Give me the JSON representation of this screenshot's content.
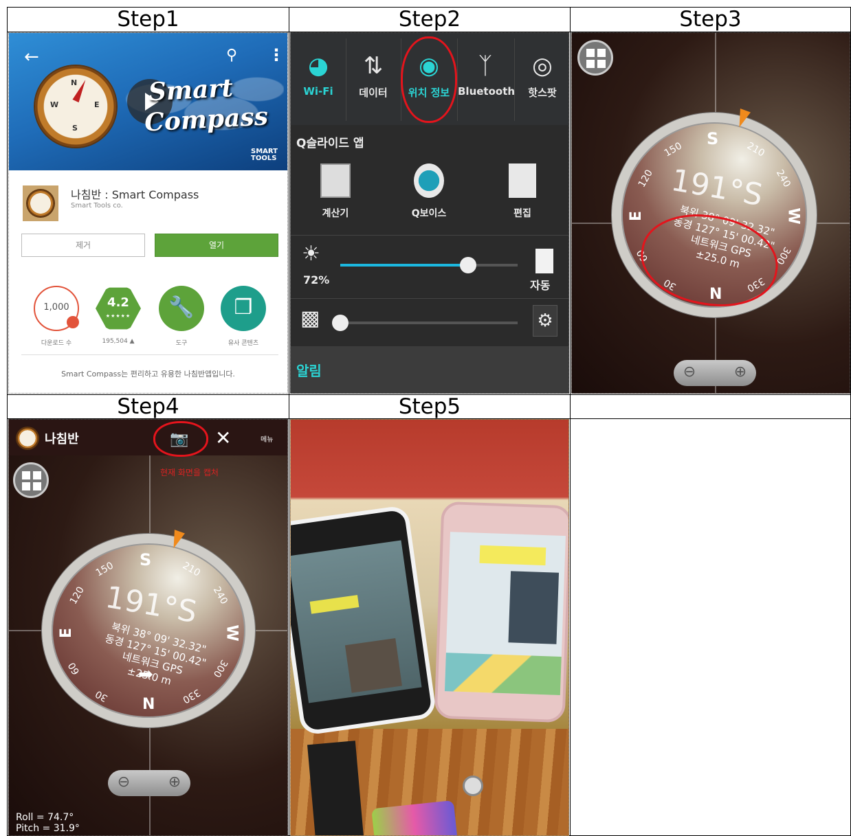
{
  "headers": {
    "step1": "Step1",
    "step2": "Step2",
    "step3": "Step3",
    "step4": "Step4",
    "step5": "Step5"
  },
  "step1": {
    "banner_title_line1": "Smart",
    "banner_title_line2": "Compass",
    "banner_brand_line1": "SMART",
    "banner_brand_line2": "TOOLS",
    "app_name": "나침반 : Smart Compass",
    "developer": "Smart Tools co.",
    "uninstall_label": "제거",
    "open_label": "열기",
    "downloads_value": "1,000",
    "downloads_label": "다운로드 수",
    "rating_value": "4.2",
    "rating_stars": "★★★★★",
    "rating_count": "195,504 ▲",
    "category_label": "도구",
    "similar_label": "유사 콘텐츠",
    "description": "Smart Compass는 편리하고 유용한 나침반앱입니다.",
    "icons": [
      "back-arrow",
      "search",
      "more-vert",
      "play",
      "download",
      "wrench",
      "cards"
    ],
    "colors": {
      "banner": "#1f6cb8",
      "open_button": "#5da33a"
    }
  },
  "step2": {
    "tiles": [
      {
        "label": "Wi-Fi",
        "icon": "wifi-icon",
        "active": true
      },
      {
        "label": "데이터",
        "icon": "data-icon",
        "active": false
      },
      {
        "label": "위치 정보",
        "icon": "location-icon",
        "active": true
      },
      {
        "label": "Bluetooth",
        "icon": "bluetooth-icon",
        "active": false
      },
      {
        "label": "핫스팟",
        "icon": "hotspot-icon",
        "active": false
      }
    ],
    "qslide_title": "Q슬라이드 앱",
    "apps": [
      {
        "label": "계산기",
        "icon": "calculator-icon"
      },
      {
        "label": "Q보이스",
        "icon": "voice-icon"
      },
      {
        "label": "편집",
        "icon": "edit-icon"
      }
    ],
    "brightness_pct": "72%",
    "brightness_value": 0.72,
    "auto_label": "자동",
    "volume_value": 0.0,
    "notice_label": "알림",
    "colors": {
      "accent": "#2bd4d4",
      "highlight": "#e4141c"
    }
  },
  "compass": {
    "dir_s": "S",
    "dir_e": "E",
    "dir_w": "W",
    "dir_n": "N",
    "deg_150": "150",
    "deg_210": "210",
    "deg_120": "120",
    "deg_240": "240",
    "deg_60": "60",
    "deg_300": "300",
    "deg_30": "30",
    "deg_330": "330",
    "heading": "191°S",
    "lat": "북위 38° 09' 32.32\"",
    "lon": "동경 127° 15' 00.42\"",
    "gps": "네트워크 GPS",
    "accuracy": "±25.0 m"
  },
  "step4": {
    "app_title": "나침반",
    "menu_label": "메뉴",
    "caption": "현재 화면을 캡처",
    "roll": "Roll = 74.7°",
    "pitch": "Pitch = 31.9°"
  }
}
